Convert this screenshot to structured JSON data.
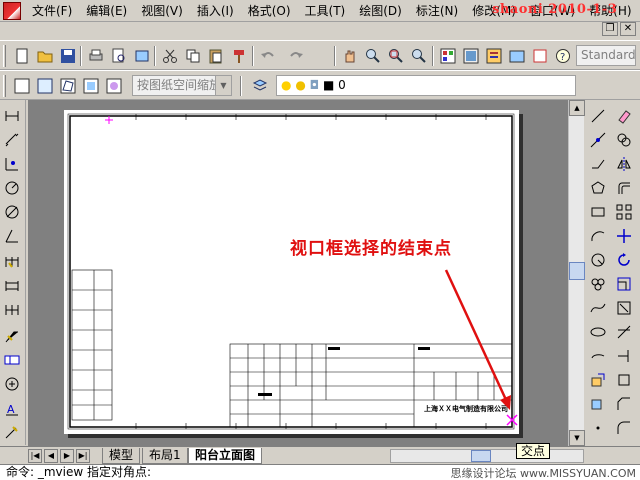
{
  "menu": [
    "文件(F)",
    "编辑(E)",
    "视图(V)",
    "插入(I)",
    "格式(O)",
    "工具(T)",
    "绘图(D)",
    "标注(N)",
    "修改(M)",
    "窗口(W)",
    "帮助(H)"
  ],
  "watermark": "shaoni 2010-1-3",
  "toolbar": {
    "text_style_combo": "Standard",
    "viewport_scale_combo": "按图纸空间缩放",
    "layer_combo": "0"
  },
  "annotation": "视口框选择的结束点",
  "title_block": {
    "company": "上海ＸＸ电气制造有限公司"
  },
  "tabs": [
    "模型",
    "布局1",
    "阳台立面图"
  ],
  "active_tab": "阳台立面图",
  "snap_tooltip": "交点",
  "command_line": "命令: _mview   指定对角点:",
  "footer_credit": "思缘设计论坛 www.MISSYUAN.COM",
  "colors": {
    "annotation": "#e01010",
    "crosshair": "#ff00ff",
    "background_gray": "#808080"
  }
}
